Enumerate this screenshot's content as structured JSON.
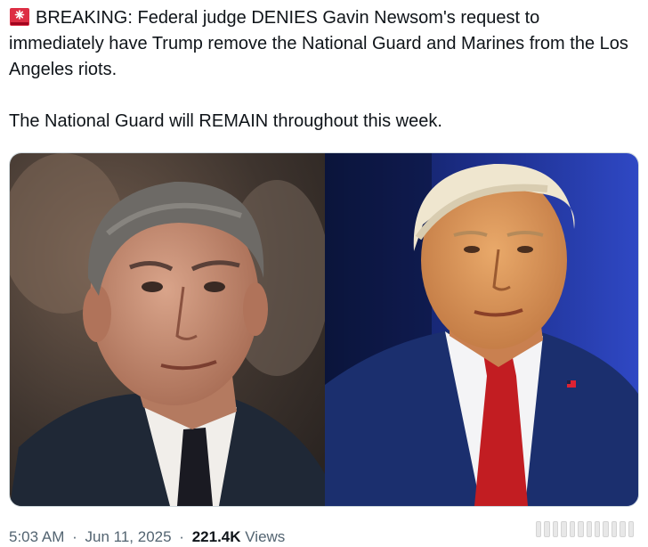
{
  "tweet": {
    "line1": "BREAKING: Federal judge DENIES Gavin Newsom's request to immediately have Trump remove the National Guard and Marines from the Los Angeles riots.",
    "line2": "The National Guard will REMAIN throughout this week.",
    "siren_icon": "police-car-light-icon"
  },
  "meta": {
    "time": "5:03 AM",
    "separator": "·",
    "date": "Jun 11, 2025",
    "views_count": "221.4K",
    "views_label": "Views"
  },
  "colors": {
    "text": "#0f1419",
    "secondary": "#536471",
    "border": "#cfd9de"
  }
}
